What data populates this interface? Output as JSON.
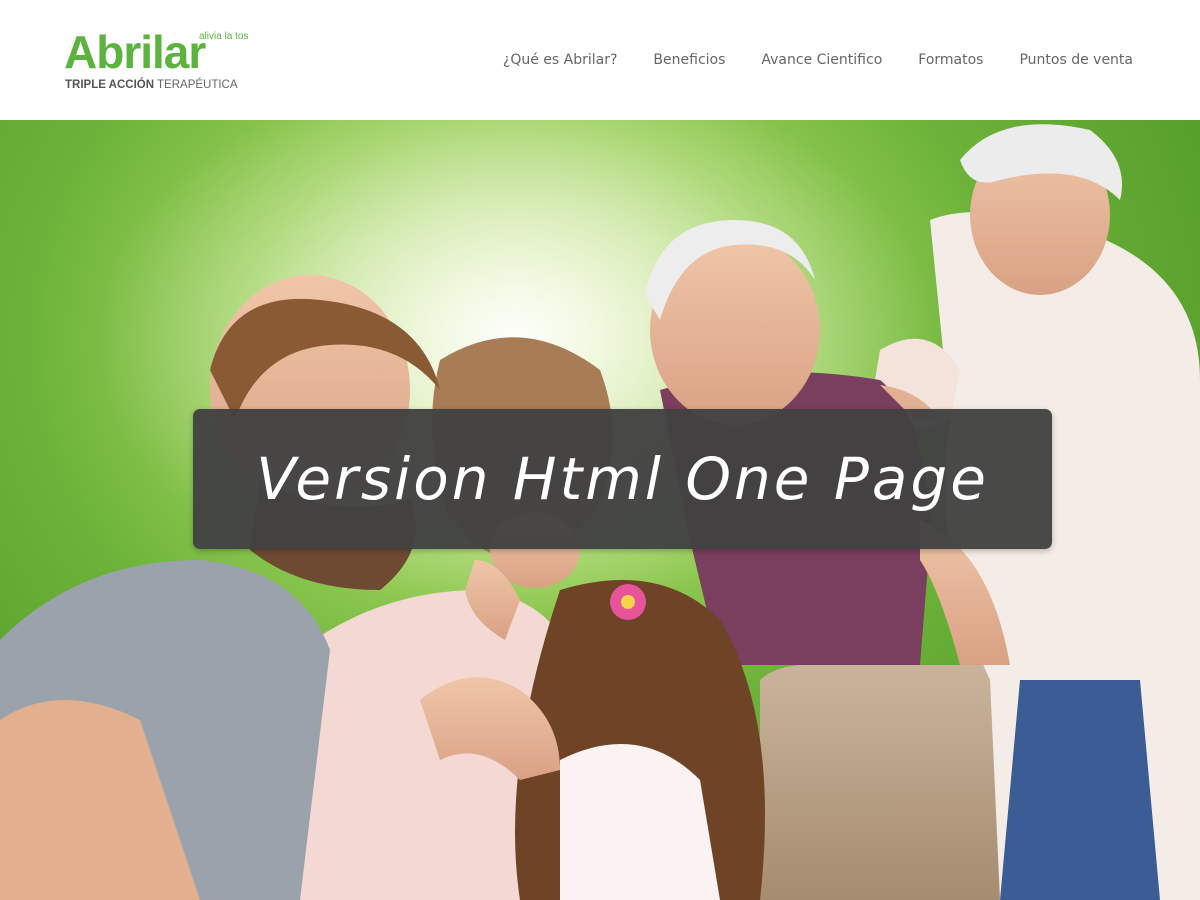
{
  "logo": {
    "name": "Abrilar",
    "tagline": "alivia la tos",
    "subtitle_bold": "TRIPLE ACCIÓN",
    "subtitle_rest": " TERAPÉUTICA"
  },
  "nav": {
    "items": [
      {
        "label": "¿Qué es Abrilar?"
      },
      {
        "label": "Beneficios"
      },
      {
        "label": "Avance Cientifico"
      },
      {
        "label": "Formatos"
      },
      {
        "label": "Puntos de venta"
      }
    ]
  },
  "hero": {
    "banner_text": "Version Html One Page"
  },
  "colors": {
    "brand_green": "#5cb33d",
    "nav_text": "#666666",
    "banner_bg": "#424242"
  }
}
